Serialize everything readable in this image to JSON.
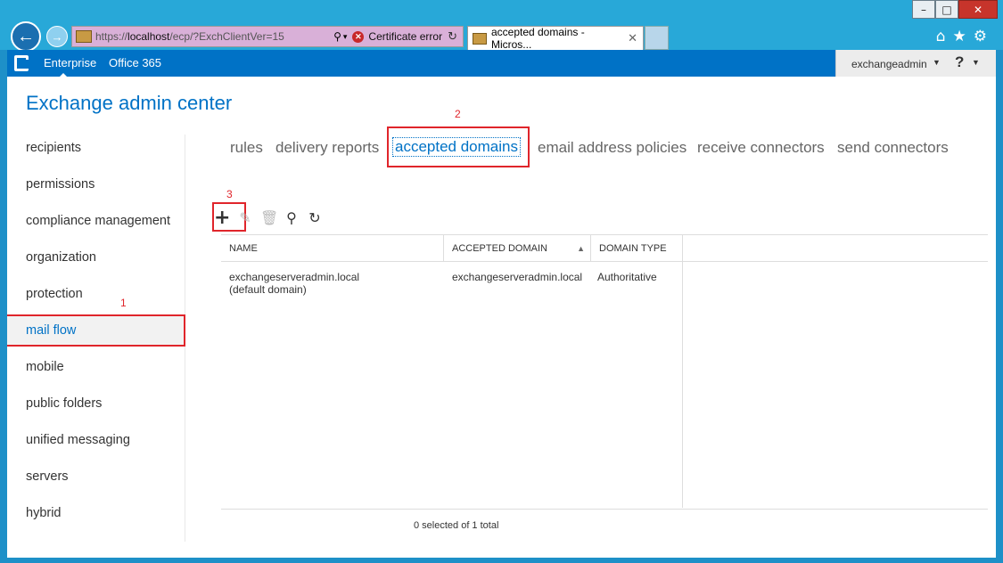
{
  "browser": {
    "address_url_prefix": "https://",
    "address_host": "localhost",
    "address_url_suffix": "/ecp/?ExchClientVer=15",
    "certificate_error": "Certificate error",
    "tab_title": "accepted domains - Micros...",
    "window_buttons": {
      "minimize": "–",
      "maximize": "□",
      "close": "✕"
    }
  },
  "o365bar": {
    "enterprise": "Enterprise",
    "office365": "Office 365",
    "user": "exchangeadmin",
    "help": "?"
  },
  "app_title": "Exchange admin center",
  "leftnav": {
    "items": [
      {
        "label": "recipients"
      },
      {
        "label": "permissions"
      },
      {
        "label": "compliance management"
      },
      {
        "label": "organization"
      },
      {
        "label": "protection"
      },
      {
        "label": "mail flow",
        "active": true
      },
      {
        "label": "mobile"
      },
      {
        "label": "public folders"
      },
      {
        "label": "unified messaging"
      },
      {
        "label": "servers"
      },
      {
        "label": "hybrid"
      }
    ]
  },
  "tabs": [
    {
      "label": "rules"
    },
    {
      "label": "delivery reports"
    },
    {
      "label": "accepted domains",
      "active": true
    },
    {
      "label": "email address policies"
    },
    {
      "label": "receive connectors"
    },
    {
      "label": "send connectors"
    }
  ],
  "annotations": {
    "one": "1",
    "two": "2",
    "three": "3"
  },
  "toolbar": {
    "add": "+",
    "edit_icon": "pencil-icon",
    "delete_icon": "trash-icon",
    "search_icon": "search-icon",
    "refresh_icon": "refresh-icon"
  },
  "grid": {
    "columns": [
      "NAME",
      "ACCEPTED DOMAIN",
      "DOMAIN TYPE"
    ],
    "sort_indicator": "▲",
    "rows": [
      [
        "exchangeserveradmin.local (default domain)",
        "exchangeserveradmin.local",
        "Authoritative"
      ]
    ]
  },
  "status": "0 selected of 1 total",
  "colors": {
    "accent": "#0072c6",
    "annotation": "#e0252b",
    "window_frame": "#1e90c8"
  }
}
